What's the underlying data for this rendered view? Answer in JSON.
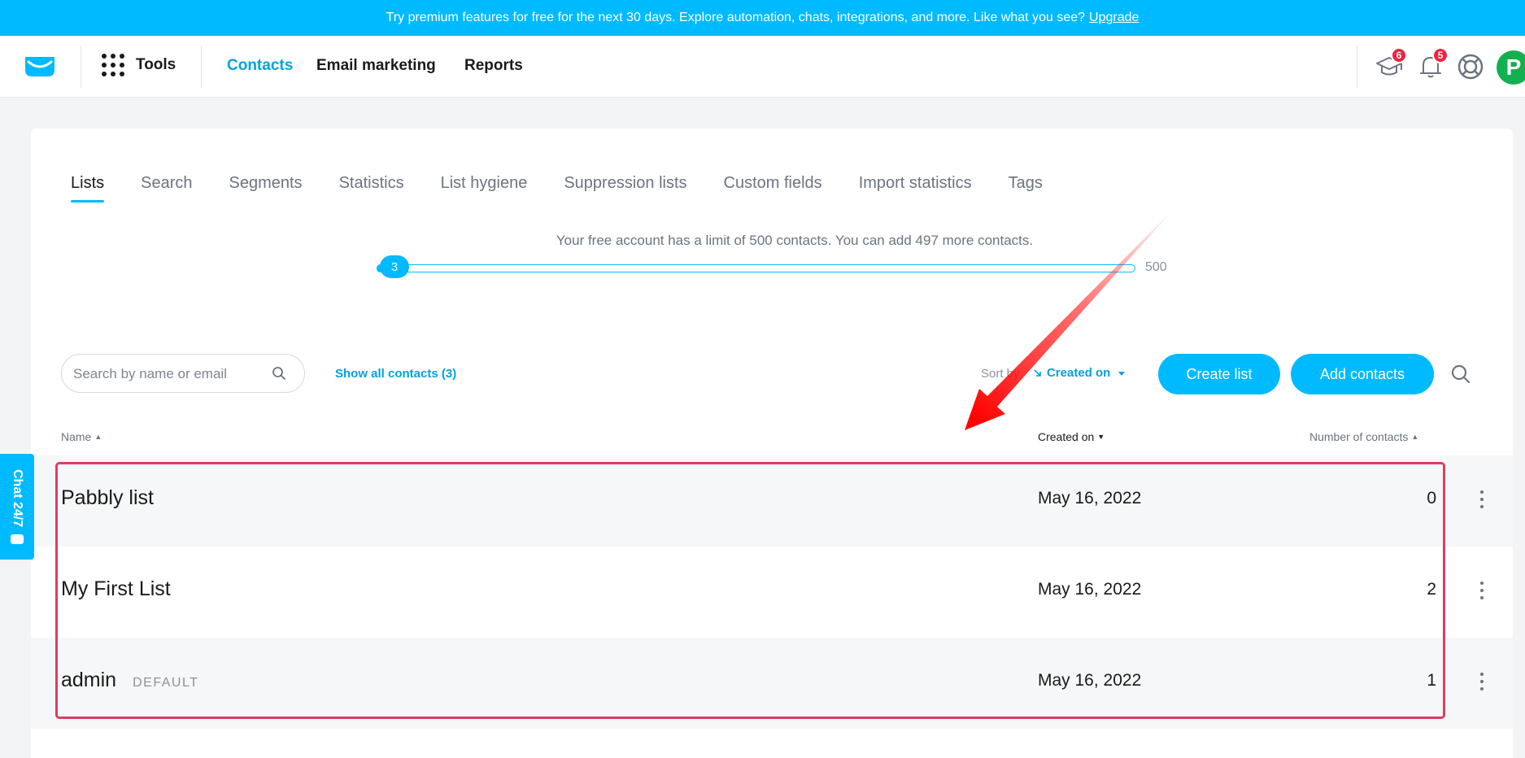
{
  "promo": {
    "text": "Try premium features for free for the next 30 days. Explore automation, chats, integrations, and more. Like what you see?",
    "link": "Upgrade"
  },
  "nav": {
    "tools": "Tools",
    "links": [
      "Contacts",
      "Email marketing",
      "Reports"
    ],
    "academy_badge": "6",
    "notifications_badge": "5",
    "avatar_letter": "P"
  },
  "tabs": [
    "Lists",
    "Search",
    "Segments",
    "Statistics",
    "List hygiene",
    "Suppression lists",
    "Custom fields",
    "Import statistics",
    "Tags"
  ],
  "limit": {
    "text": "Your free account has a limit of 500 contacts. You can add 497 more contacts.",
    "current": "3",
    "max": "500",
    "fraction": 0.006
  },
  "toolbar": {
    "search_placeholder": "Search by name or email",
    "show_all": "Show all contacts (3)",
    "sort_label": "Sort by",
    "sort_value": "Created on",
    "create_list": "Create list",
    "add_contacts": "Add contacts"
  },
  "table": {
    "headers": {
      "name": "Name",
      "created": "Created on",
      "count": "Number of contacts"
    },
    "rows": [
      {
        "name": "Pabbly list",
        "tag": "",
        "created": "May 16, 2022",
        "count": "0"
      },
      {
        "name": "My First List",
        "tag": "",
        "created": "May 16, 2022",
        "count": "2"
      },
      {
        "name": "admin",
        "tag": "DEFAULT",
        "created": "May 16, 2022",
        "count": "1"
      }
    ]
  },
  "chat": {
    "label": "Chat 24/7"
  },
  "colors": {
    "accent": "#00baff",
    "link": "#00a2e0",
    "highlight": "#e23b63",
    "arrow": "#ff1a1a"
  }
}
